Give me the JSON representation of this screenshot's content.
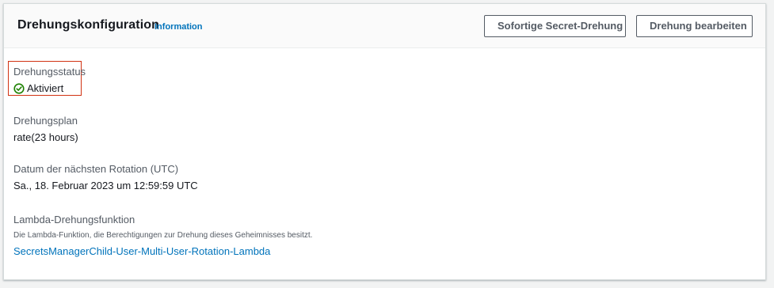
{
  "header": {
    "title": "Drehungskonfiguration",
    "info_link": "Information",
    "buttons": {
      "rotate_now": "Sofortige Secret-Drehung",
      "edit": "Drehung bearbeiten"
    }
  },
  "fields": {
    "status": {
      "label": "Drehungsstatus",
      "value": "Aktiviert",
      "icon": "check-circle-icon",
      "color": "#1d8102"
    },
    "schedule": {
      "label": "Drehungsplan",
      "value": "rate(23 hours)"
    },
    "next_rotation": {
      "label": "Datum der nächsten Rotation (UTC)",
      "value": "Sa., 18. Februar 2023 um 12:59:59 UTC"
    },
    "lambda": {
      "label": "Lambda-Drehungsfunktion",
      "description": "Die Lambda-Funktion, die Berechtigungen zur Drehung dieses Geheimnisses besitzt.",
      "link": "SecretsManagerChild-User-Multi-User-Rotation-Lambda"
    }
  },
  "colors": {
    "link": "#0073bb",
    "highlight_border": "#d13212",
    "success": "#1d8102"
  }
}
